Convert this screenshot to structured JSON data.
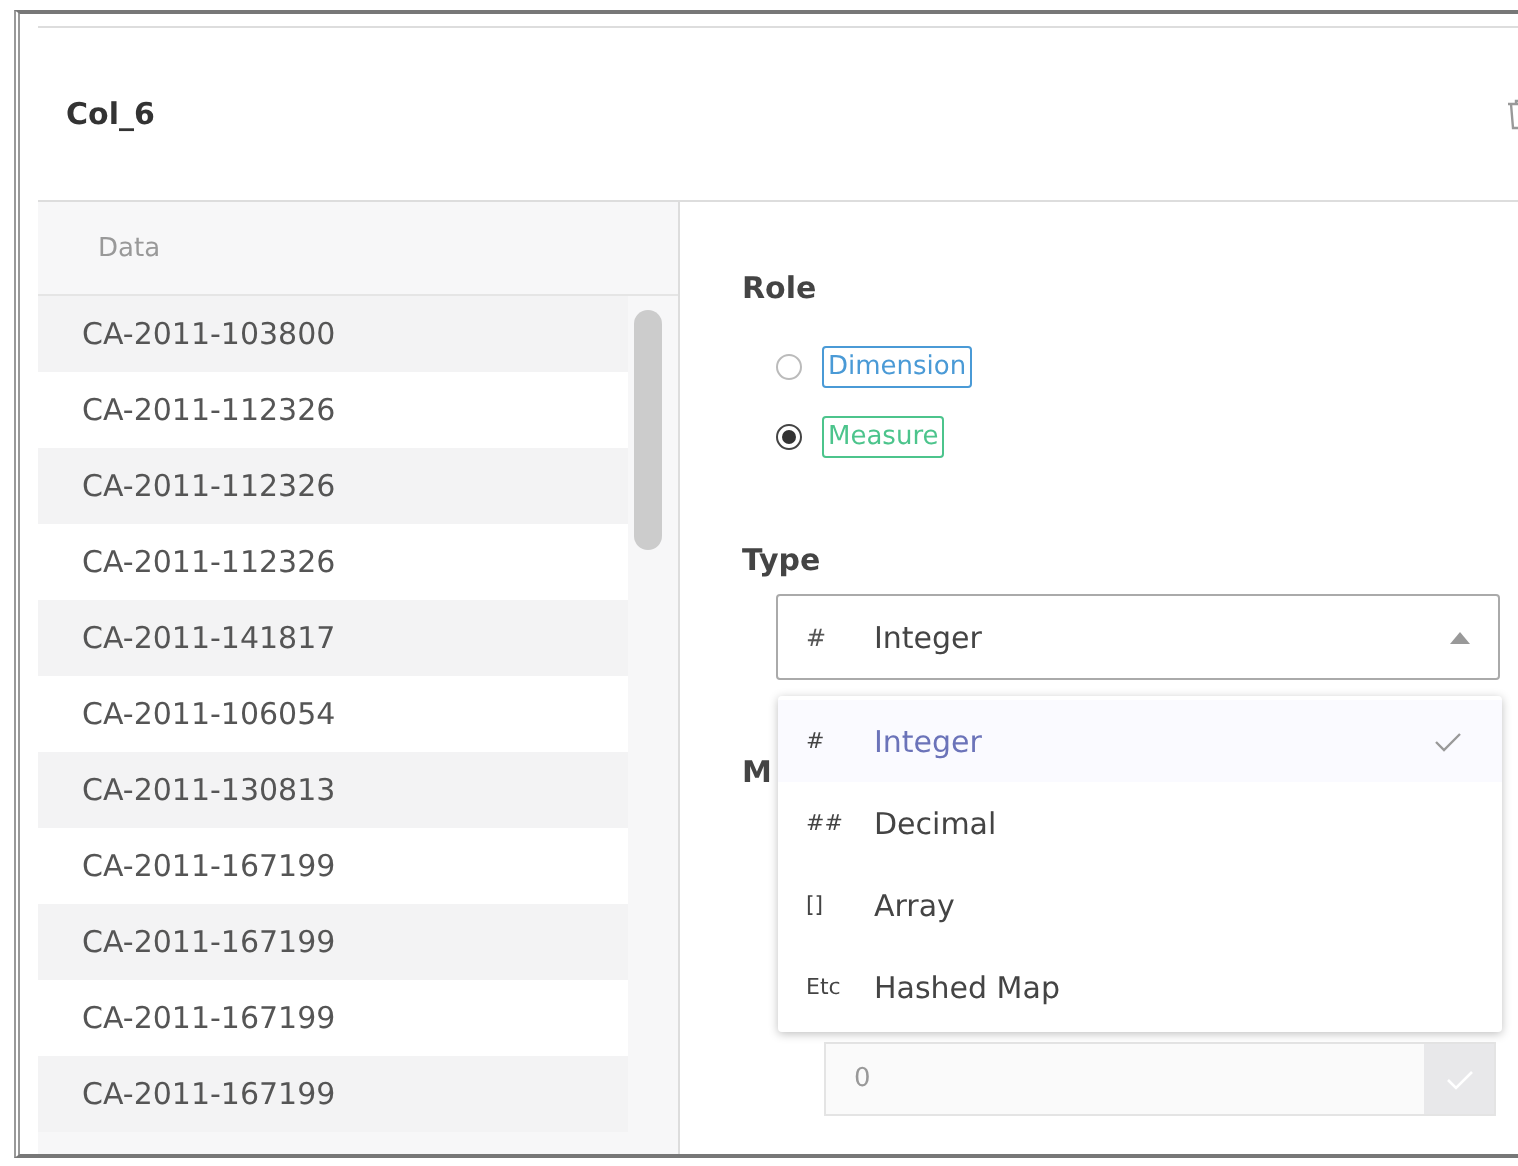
{
  "header": {
    "title": "Col_6"
  },
  "data_list": {
    "heading": "Data",
    "rows": [
      "CA-2011-103800",
      "CA-2011-112326",
      "CA-2011-112326",
      "CA-2011-112326",
      "CA-2011-141817",
      "CA-2011-106054",
      "CA-2011-130813",
      "CA-2011-167199",
      "CA-2011-167199",
      "CA-2011-167199",
      "CA-2011-167199"
    ]
  },
  "role": {
    "label": "Role",
    "options": [
      {
        "label": "Dimension",
        "selected": false,
        "color": "#4a9ad6"
      },
      {
        "label": "Measure",
        "selected": true,
        "color": "#4cc48c"
      }
    ]
  },
  "type": {
    "label": "Type",
    "value_symbol": "#",
    "value": "Integer",
    "expanded": true,
    "options": [
      {
        "symbol": "#",
        "label": "Integer",
        "selected": true
      },
      {
        "symbol": "##",
        "label": "Decimal",
        "selected": false
      },
      {
        "symbol": "[]",
        "label": "Array",
        "selected": false
      },
      {
        "symbol": "Etc",
        "label": "Hashed Map",
        "selected": false
      }
    ]
  },
  "partial_label": "M",
  "bottom_field": {
    "placeholder": "0",
    "disabled": true
  }
}
